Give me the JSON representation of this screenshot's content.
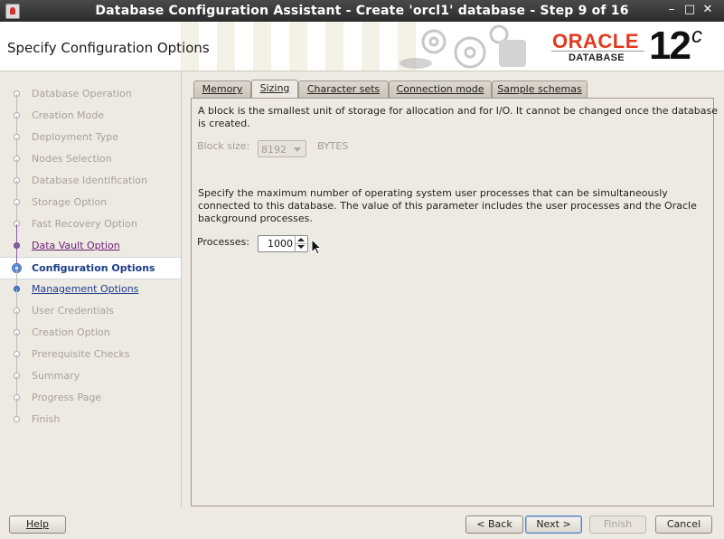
{
  "window": {
    "title": "Database Configuration Assistant - Create 'orcl1' database - Step 9 of 16",
    "minimize": "–",
    "maximize": "□",
    "close": "✕"
  },
  "header": {
    "page_title": "Specify Configuration Options",
    "logo_brand": "ORACLE",
    "logo_product": "DATABASE",
    "logo_version": "12",
    "logo_version_suffix": "c"
  },
  "steps": [
    {
      "label": "Database Operation",
      "state": "disabled"
    },
    {
      "label": "Creation Mode",
      "state": "disabled"
    },
    {
      "label": "Deployment Type",
      "state": "disabled"
    },
    {
      "label": "Nodes Selection",
      "state": "disabled"
    },
    {
      "label": "Database Identification",
      "state": "disabled"
    },
    {
      "label": "Storage Option",
      "state": "disabled"
    },
    {
      "label": "Fast Recovery Option",
      "state": "disabled"
    },
    {
      "label": "Data Vault Option",
      "state": "visited"
    },
    {
      "label": "Configuration Options",
      "state": "current"
    },
    {
      "label": "Management Options",
      "state": "link"
    },
    {
      "label": "User Credentials",
      "state": "disabled"
    },
    {
      "label": "Creation Option",
      "state": "disabled"
    },
    {
      "label": "Prerequisite Checks",
      "state": "disabled"
    },
    {
      "label": "Summary",
      "state": "disabled"
    },
    {
      "label": "Progress Page",
      "state": "disabled"
    },
    {
      "label": "Finish",
      "state": "disabled"
    }
  ],
  "tabs": {
    "memory": "Memory",
    "sizing": "Sizing",
    "charsets": "Character sets",
    "connection": "Connection mode",
    "samples": "Sample schemas",
    "active": "Sizing"
  },
  "sizing": {
    "block_desc_line1": "A block is the smallest unit of storage for allocation and for I/O. It cannot be changed once the database",
    "block_desc_line2": "is created.",
    "block_size_label": "Block size:",
    "block_size_value": "8192",
    "block_size_unit": "BYTES",
    "proc_desc_line1": "Specify the maximum number of operating system user processes that can be simultaneously",
    "proc_desc_line2": "connected to this database. The value of this parameter includes the user processes and the Oracle",
    "proc_desc_line3": "background processes.",
    "processes_label": "Processes:",
    "processes_value": "1000"
  },
  "buttons": {
    "help": "Help",
    "back": "< Back",
    "next": "Next >",
    "finish": "Finish",
    "cancel": "Cancel"
  },
  "colors": {
    "oracle_red": "#e03a1e",
    "link_blue": "#1f3a8a",
    "visited_purple": "#6d1b74"
  }
}
